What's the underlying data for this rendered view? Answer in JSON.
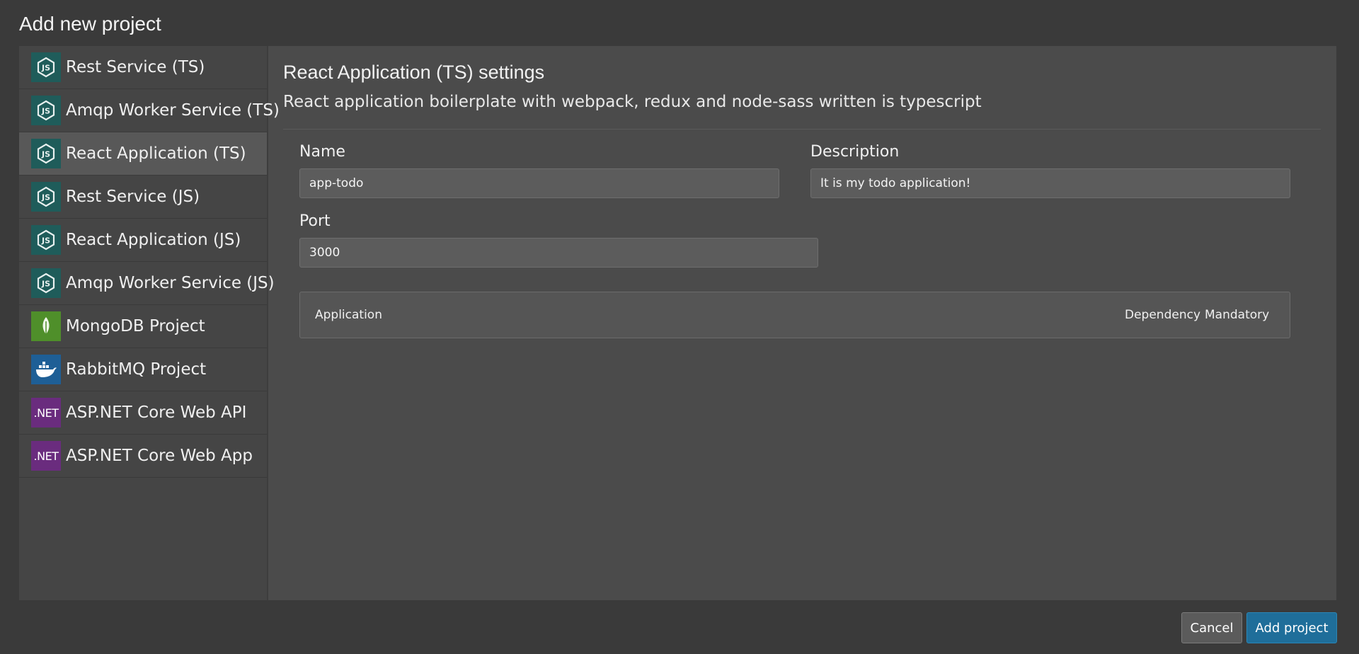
{
  "dialog": {
    "title": "Add new project"
  },
  "sidebar": {
    "items": [
      {
        "label": "Rest Service (TS)",
        "icon": "nodejs-icon",
        "selected": false
      },
      {
        "label": "Amqp Worker Service (TS)",
        "icon": "nodejs-icon",
        "selected": false
      },
      {
        "label": "React Application (TS)",
        "icon": "nodejs-icon",
        "selected": true
      },
      {
        "label": "Rest Service (JS)",
        "icon": "nodejs-icon",
        "selected": false
      },
      {
        "label": "React Application (JS)",
        "icon": "nodejs-icon",
        "selected": false
      },
      {
        "label": "Amqp Worker Service (JS)",
        "icon": "nodejs-icon",
        "selected": false
      },
      {
        "label": "MongoDB Project",
        "icon": "mongodb-leaf-icon",
        "selected": false
      },
      {
        "label": "RabbitMQ Project",
        "icon": "docker-whale-icon",
        "selected": false
      },
      {
        "label": "ASP.NET Core Web API",
        "icon": "dotnet-icon",
        "icon_text": ".NET",
        "selected": false
      },
      {
        "label": "ASP.NET Core Web App",
        "icon": "dotnet-icon",
        "icon_text": ".NET",
        "selected": false
      }
    ]
  },
  "settings": {
    "title": "React Application (TS) settings",
    "description": "React application boilerplate with webpack, redux and node-sass written is typescript",
    "fields": {
      "name": {
        "label": "Name",
        "value": "app-todo"
      },
      "description": {
        "label": "Description",
        "value": "It is my todo application!"
      },
      "port": {
        "label": "Port",
        "value": "3000"
      }
    },
    "dependencies_table": {
      "columns": [
        "Application",
        "Dependency",
        "Mandatory"
      ]
    }
  },
  "footer": {
    "cancel_label": "Cancel",
    "add_label": "Add project"
  },
  "colors": {
    "background": "#3a3a3a",
    "panel": "#4b4b4b",
    "sidebar": "#454545",
    "selected_item": "#585858",
    "primary_button": "#1f6e9a",
    "nodejs_icon_bg": "#1f5c5a",
    "mongodb_icon_bg": "#4f8f2a",
    "rabbitmq_icon_bg": "#1e5f96",
    "dotnet_icon_bg": "#6a2c7e"
  }
}
